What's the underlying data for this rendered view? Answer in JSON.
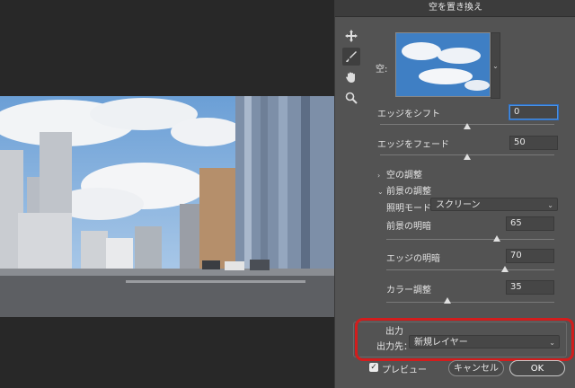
{
  "dialog": {
    "title": "空を置き換え",
    "sky_label": "空:",
    "sky_dropdown_arrow": "⌄",
    "fields": {
      "edge_shift": {
        "label": "エッジをシフト",
        "value": "0",
        "level": 0.5
      },
      "edge_fade": {
        "label": "エッジをフェード",
        "value": "50",
        "level": 0.5
      }
    },
    "sections": {
      "sky_adjust": {
        "label": "空の調整",
        "chevron": "›"
      },
      "foreground_adjust": {
        "label": "前景の調整",
        "chevron": "⌄"
      }
    },
    "lighting_mode": {
      "label": "照明モード：",
      "value": "スクリーン",
      "arrow": "⌄"
    },
    "fg_lighting": {
      "label": "前景の明暗",
      "value": "65",
      "level": 0.65
    },
    "edge_lighting": {
      "label": "エッジの明暗",
      "value": "70",
      "level": 0.7
    },
    "color_adjust": {
      "label": "カラー調整",
      "value": "35",
      "level": 0.35
    },
    "output": {
      "section_label": "出力",
      "dest_label": "出力先：",
      "dest_value": "新規レイヤー",
      "arrow": "⌄"
    },
    "preview": {
      "label": "プレビュー",
      "checked": true,
      "checkmark": "✓"
    },
    "buttons": {
      "cancel": "キャンセル",
      "ok": "OK"
    }
  },
  "tools": [
    "move-tool-icon",
    "sky-brush-icon",
    "hand-icon",
    "zoom-icon"
  ],
  "colors": {
    "highlight_ring": "#d21d1d",
    "focus": "#4a90e2"
  }
}
